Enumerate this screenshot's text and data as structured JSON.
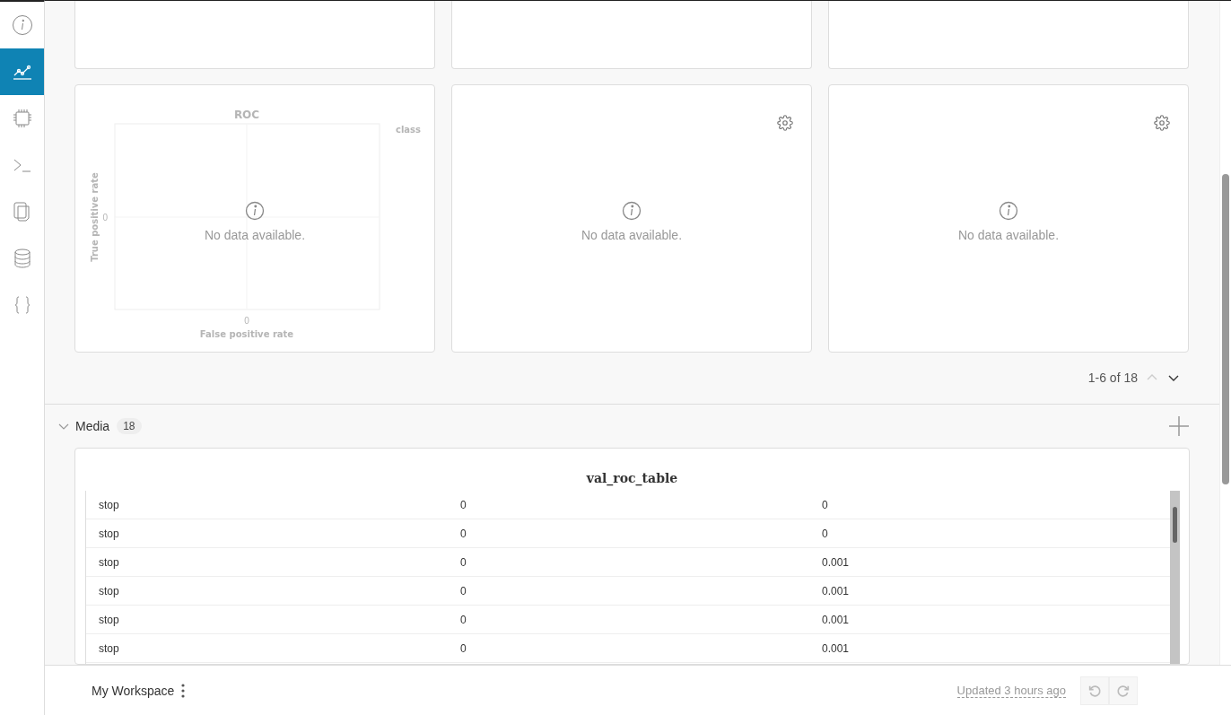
{
  "sidebar": {
    "items": [
      {
        "selected": false
      },
      {
        "selected": true
      },
      {
        "selected": false
      },
      {
        "selected": false
      },
      {
        "selected": false
      },
      {
        "selected": false
      },
      {
        "selected": false
      }
    ]
  },
  "top_panels": [
    {
      "kind": "empty"
    },
    {
      "kind": "empty"
    },
    {
      "kind": "empty"
    }
  ],
  "panels": [
    {
      "kind": "roc",
      "message": "No data available.",
      "legend_title": "class",
      "plot": {
        "title": "ROC",
        "xlabel": "False positive rate",
        "ylabel": "True positive rate",
        "x_tick": "0",
        "y_tick": "0"
      }
    },
    {
      "kind": "blank",
      "message": "No data available.",
      "settings": true
    },
    {
      "kind": "blank",
      "message": "No data available.",
      "settings": true
    }
  ],
  "pagination": {
    "text": "1-6 of 18",
    "prev_disabled": true,
    "next_disabled": false
  },
  "media": {
    "title": "Media",
    "count": "18",
    "expanded": true,
    "table_title": "val_roc_table",
    "rows": [
      [
        "stop",
        "0",
        "0"
      ],
      [
        "stop",
        "0",
        "0"
      ],
      [
        "stop",
        "0",
        "0.001"
      ],
      [
        "stop",
        "0",
        "0.001"
      ],
      [
        "stop",
        "0",
        "0.001"
      ],
      [
        "stop",
        "0",
        "0.001"
      ]
    ]
  },
  "footer": {
    "workspace": "My Workspace",
    "updated": "Updated 3 hours ago"
  }
}
